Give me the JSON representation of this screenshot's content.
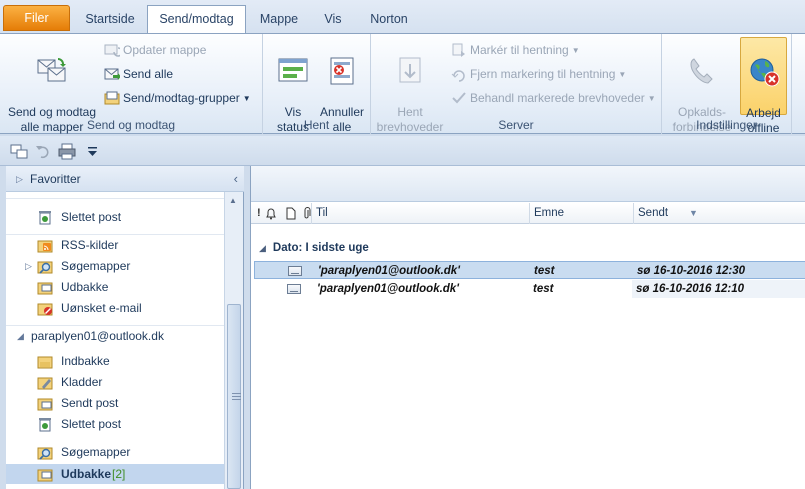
{
  "tabs": [
    {
      "label": "Filer"
    },
    {
      "label": "Startside"
    },
    {
      "label": "Send/modtag"
    },
    {
      "label": "Mappe"
    },
    {
      "label": "Vis"
    },
    {
      "label": "Norton"
    }
  ],
  "ribbon": {
    "groups": {
      "send_receive": {
        "label": "Send og modtag",
        "send_all_folders": "Send og modtag\nalle mapper",
        "update_folder": "Opdater mappe",
        "send_all": "Send alle",
        "groups_dropdown": "Send/modtag-grupper"
      },
      "download": {
        "label": "Hent",
        "show_status": "Vis\nstatus",
        "cancel_all": "Annuller\nalle"
      },
      "server": {
        "label": "Server",
        "download_headers": "Hent\nbrevhoveder",
        "mark_download": "Markér til hentning",
        "unmark_download": "Fjern markering til hentning",
        "process_marked": "Behandl markerede brevhoveder"
      },
      "preferences": {
        "label": "Indstillinger",
        "dialup": "Opkalds-\nforbindelse",
        "work_offline": "Arbejd\noffline"
      }
    }
  },
  "nav": {
    "favorites": "Favoritter",
    "items": [
      {
        "label": "Slettet post",
        "icon": "deleted-items-icon"
      },
      {
        "label": "RSS-kilder",
        "icon": "rss-icon"
      },
      {
        "label": "Søgemapper",
        "icon": "search-folder-icon"
      },
      {
        "label": "Udbakke",
        "icon": "outbox-icon"
      },
      {
        "label": "Uønsket e-mail",
        "icon": "junk-icon"
      },
      {
        "label": "paraplyen01@outlook.dk",
        "icon": ""
      },
      {
        "label": "Indbakke",
        "icon": "inbox-icon"
      },
      {
        "label": "Kladder",
        "icon": "drafts-icon"
      },
      {
        "label": "Sendt post",
        "icon": "sent-icon"
      },
      {
        "label": "Slettet post",
        "icon": "deleted-items-icon"
      },
      {
        "label": "Søgemapper",
        "icon": "search-folder-icon"
      },
      {
        "label": "Udbakke",
        "icon": "outbox-icon",
        "count": "[2]"
      }
    ]
  },
  "mail": {
    "columns": {
      "to": "Til",
      "subject": "Emne",
      "sent": "Sendt"
    },
    "group_label": "Dato: I sidste uge",
    "messages": [
      {
        "to": "'paraplyen01@outlook.dk'",
        "subject": "test",
        "sent": "sø 16-10-2016 12:30"
      },
      {
        "to": "'paraplyen01@outlook.dk'",
        "subject": "test",
        "sent": "sø 16-10-2016 12:10"
      }
    ]
  }
}
